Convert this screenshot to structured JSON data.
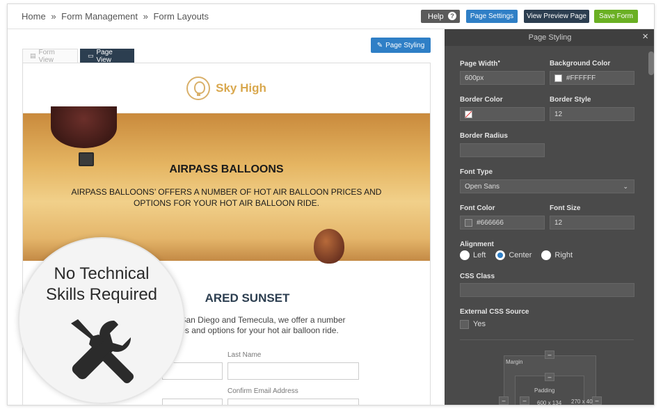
{
  "breadcrumb": {
    "home": "Home",
    "sep1": "»",
    "form_management": "Form Management",
    "sep2": "»",
    "form_layouts": "Form Layouts"
  },
  "toolbar": {
    "help_label": "Help",
    "help_glyph": "?",
    "page_settings_label": "Page Settings",
    "view_preview_label": "View Preview Page",
    "save_form_label": "Save Form"
  },
  "canvas": {
    "page_styling_label": "Page Styling",
    "tabs": [
      {
        "label": "Form View"
      },
      {
        "label": "Page View"
      }
    ],
    "logo_text": "Sky High",
    "hero_title": "AIRPASS BALLOONS",
    "hero_description": "AIRPASS BALLOONS’ OFFERS A NUMBER OF HOT AIR BALLOON PRICES AND OPTIONS FOR YOUR HOT AIR BALLOON RIDE.",
    "section_title": "ARED SUNSET",
    "section_description_line1": "n San Diego and Temecula, we offer a number",
    "section_description_line2": "es and options for your hot air balloon ride.",
    "fields": [
      {
        "label": "Last Name"
      },
      {
        "label": "Confirm Email Address"
      }
    ]
  },
  "overlay": {
    "line1": "No Technical",
    "line2": "Skills Required"
  },
  "panel": {
    "title": "Page Styling",
    "close_glyph": "×",
    "page_width": {
      "label": "Page Width",
      "sup": "●",
      "value": "600px"
    },
    "background_color": {
      "label": "Background Color",
      "value": "#FFFFFF",
      "swatch": "#FFFFFF"
    },
    "border_color": {
      "label": "Border Color",
      "value": ""
    },
    "border_style": {
      "label": "Border Style",
      "value": "12"
    },
    "border_radius": {
      "label": "Border Radius",
      "value": ""
    },
    "font_type": {
      "label": "Font Type",
      "value": "Open Sans"
    },
    "font_color": {
      "label": "Font Color",
      "value": "#666666",
      "swatch": "#666666"
    },
    "font_size": {
      "label": "Font Size",
      "value": "12"
    },
    "alignment": {
      "label": "Alignment",
      "options": [
        "Left",
        "Center",
        "Right"
      ],
      "selected": "Center"
    },
    "css_class": {
      "label": "CSS Class",
      "value": ""
    },
    "external_css": {
      "label": "External CSS Source",
      "checkbox_label": "Yes"
    },
    "box_model": {
      "margin_label": "Margin",
      "padding_label": "Padding",
      "size_inner": "600 x 134",
      "size_outer": "270 x 40"
    }
  },
  "colors": {
    "accent": "#2f7fc6",
    "dark": "#2c3e50",
    "save": "#6ab023",
    "panel_bg": "#4a4a4a"
  }
}
